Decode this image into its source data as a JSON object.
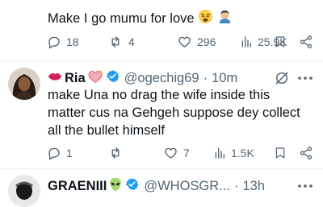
{
  "post1": {
    "text": "Make I go mumu for love",
    "emojis": [
      "weary-face-emoji",
      "facepalm-emoji"
    ],
    "stats": {
      "replies": "18",
      "reposts": "4",
      "likes": "296",
      "views": "25.9K"
    }
  },
  "post2": {
    "display_name": "Ria",
    "name_emojis": [
      "lips-emoji",
      "sparkling-heart-emoji"
    ],
    "handle": "@ogechig69",
    "separator": "·",
    "time": "10m",
    "lines": [
      "make Una no drag the wife inside this",
      "matter cus na Gehgeh suppose dey collect",
      "all the bullet himself"
    ],
    "stats": {
      "replies": "1",
      "reposts": "",
      "likes": "7",
      "views": "1.5K"
    }
  },
  "post3": {
    "display_name": "GRAENIII",
    "name_emojis": [
      "alien-emoji"
    ],
    "handle": "@WHOSGR...",
    "separator": "·",
    "time": "13h"
  },
  "colors": {
    "text": "#0f1419",
    "secondary": "#536471",
    "verified": "#1d9bf0",
    "divider": "#eff3f4"
  }
}
